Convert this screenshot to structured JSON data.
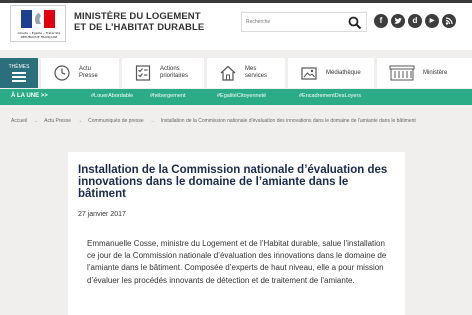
{
  "header": {
    "logo_text": "Liberté • Égalité • Fraternité RÉPUBLIQUE FRANÇAISE",
    "ministry_line1": "MINISTÈRE DU LOGEMENT",
    "ministry_line2": "ET DE L'HABITAT DURABLE",
    "search_placeholder": "Recherche",
    "socials": [
      "f",
      "t",
      "d",
      "▶",
      "rss"
    ],
    "colors": {
      "flag_blue": "#1f3f8f",
      "flag_white": "#ffffff",
      "flag_red": "#e1000f"
    }
  },
  "nav": {
    "themes_label": "THÈMES",
    "items": [
      {
        "icon": "clock-icon",
        "label1": "Actu",
        "label2": "Presse"
      },
      {
        "icon": "checklist-icon",
        "label1": "Actions",
        "label2": "prioritaires"
      },
      {
        "icon": "home-icon",
        "label1": "Mes",
        "label2": "services"
      },
      {
        "icon": "media-icon",
        "label1": "Médiathèque",
        "label2": ""
      },
      {
        "icon": "building-icon",
        "label1": "Ministère",
        "label2": ""
      }
    ]
  },
  "une": {
    "label": "À LA UNE >>",
    "tags": [
      "#LouerAbordable",
      "#hébergement",
      "#EgalitéCitoyenneté",
      "#EncadrementDesLoyers"
    ],
    "color": "#2bab86"
  },
  "breadcrumb": {
    "items": [
      "Accueil",
      "Actu Presse",
      "Communiqués de presse"
    ],
    "current": "Installation de la Commission nationale d'évaluation des innovations dans le domaine de l'amiante dans le bâtiment"
  },
  "article": {
    "title": "Installation de la Commission nationale d’évaluation des innovations dans le domaine de l’amiante dans le bâtiment",
    "date": "27 janvier 2017",
    "body": "Emmanuelle Cosse, ministre du Logement et de l’Habitat durable, salue l’installation ce jour de la Commission nationale d’évaluation des innovations dans le domaine de l’amiante dans le bâtiment. Composée d’experts de haut niveau, elle a pour mission d’évaluer les procédés innovants de détection et de traitement de l’amiante."
  }
}
